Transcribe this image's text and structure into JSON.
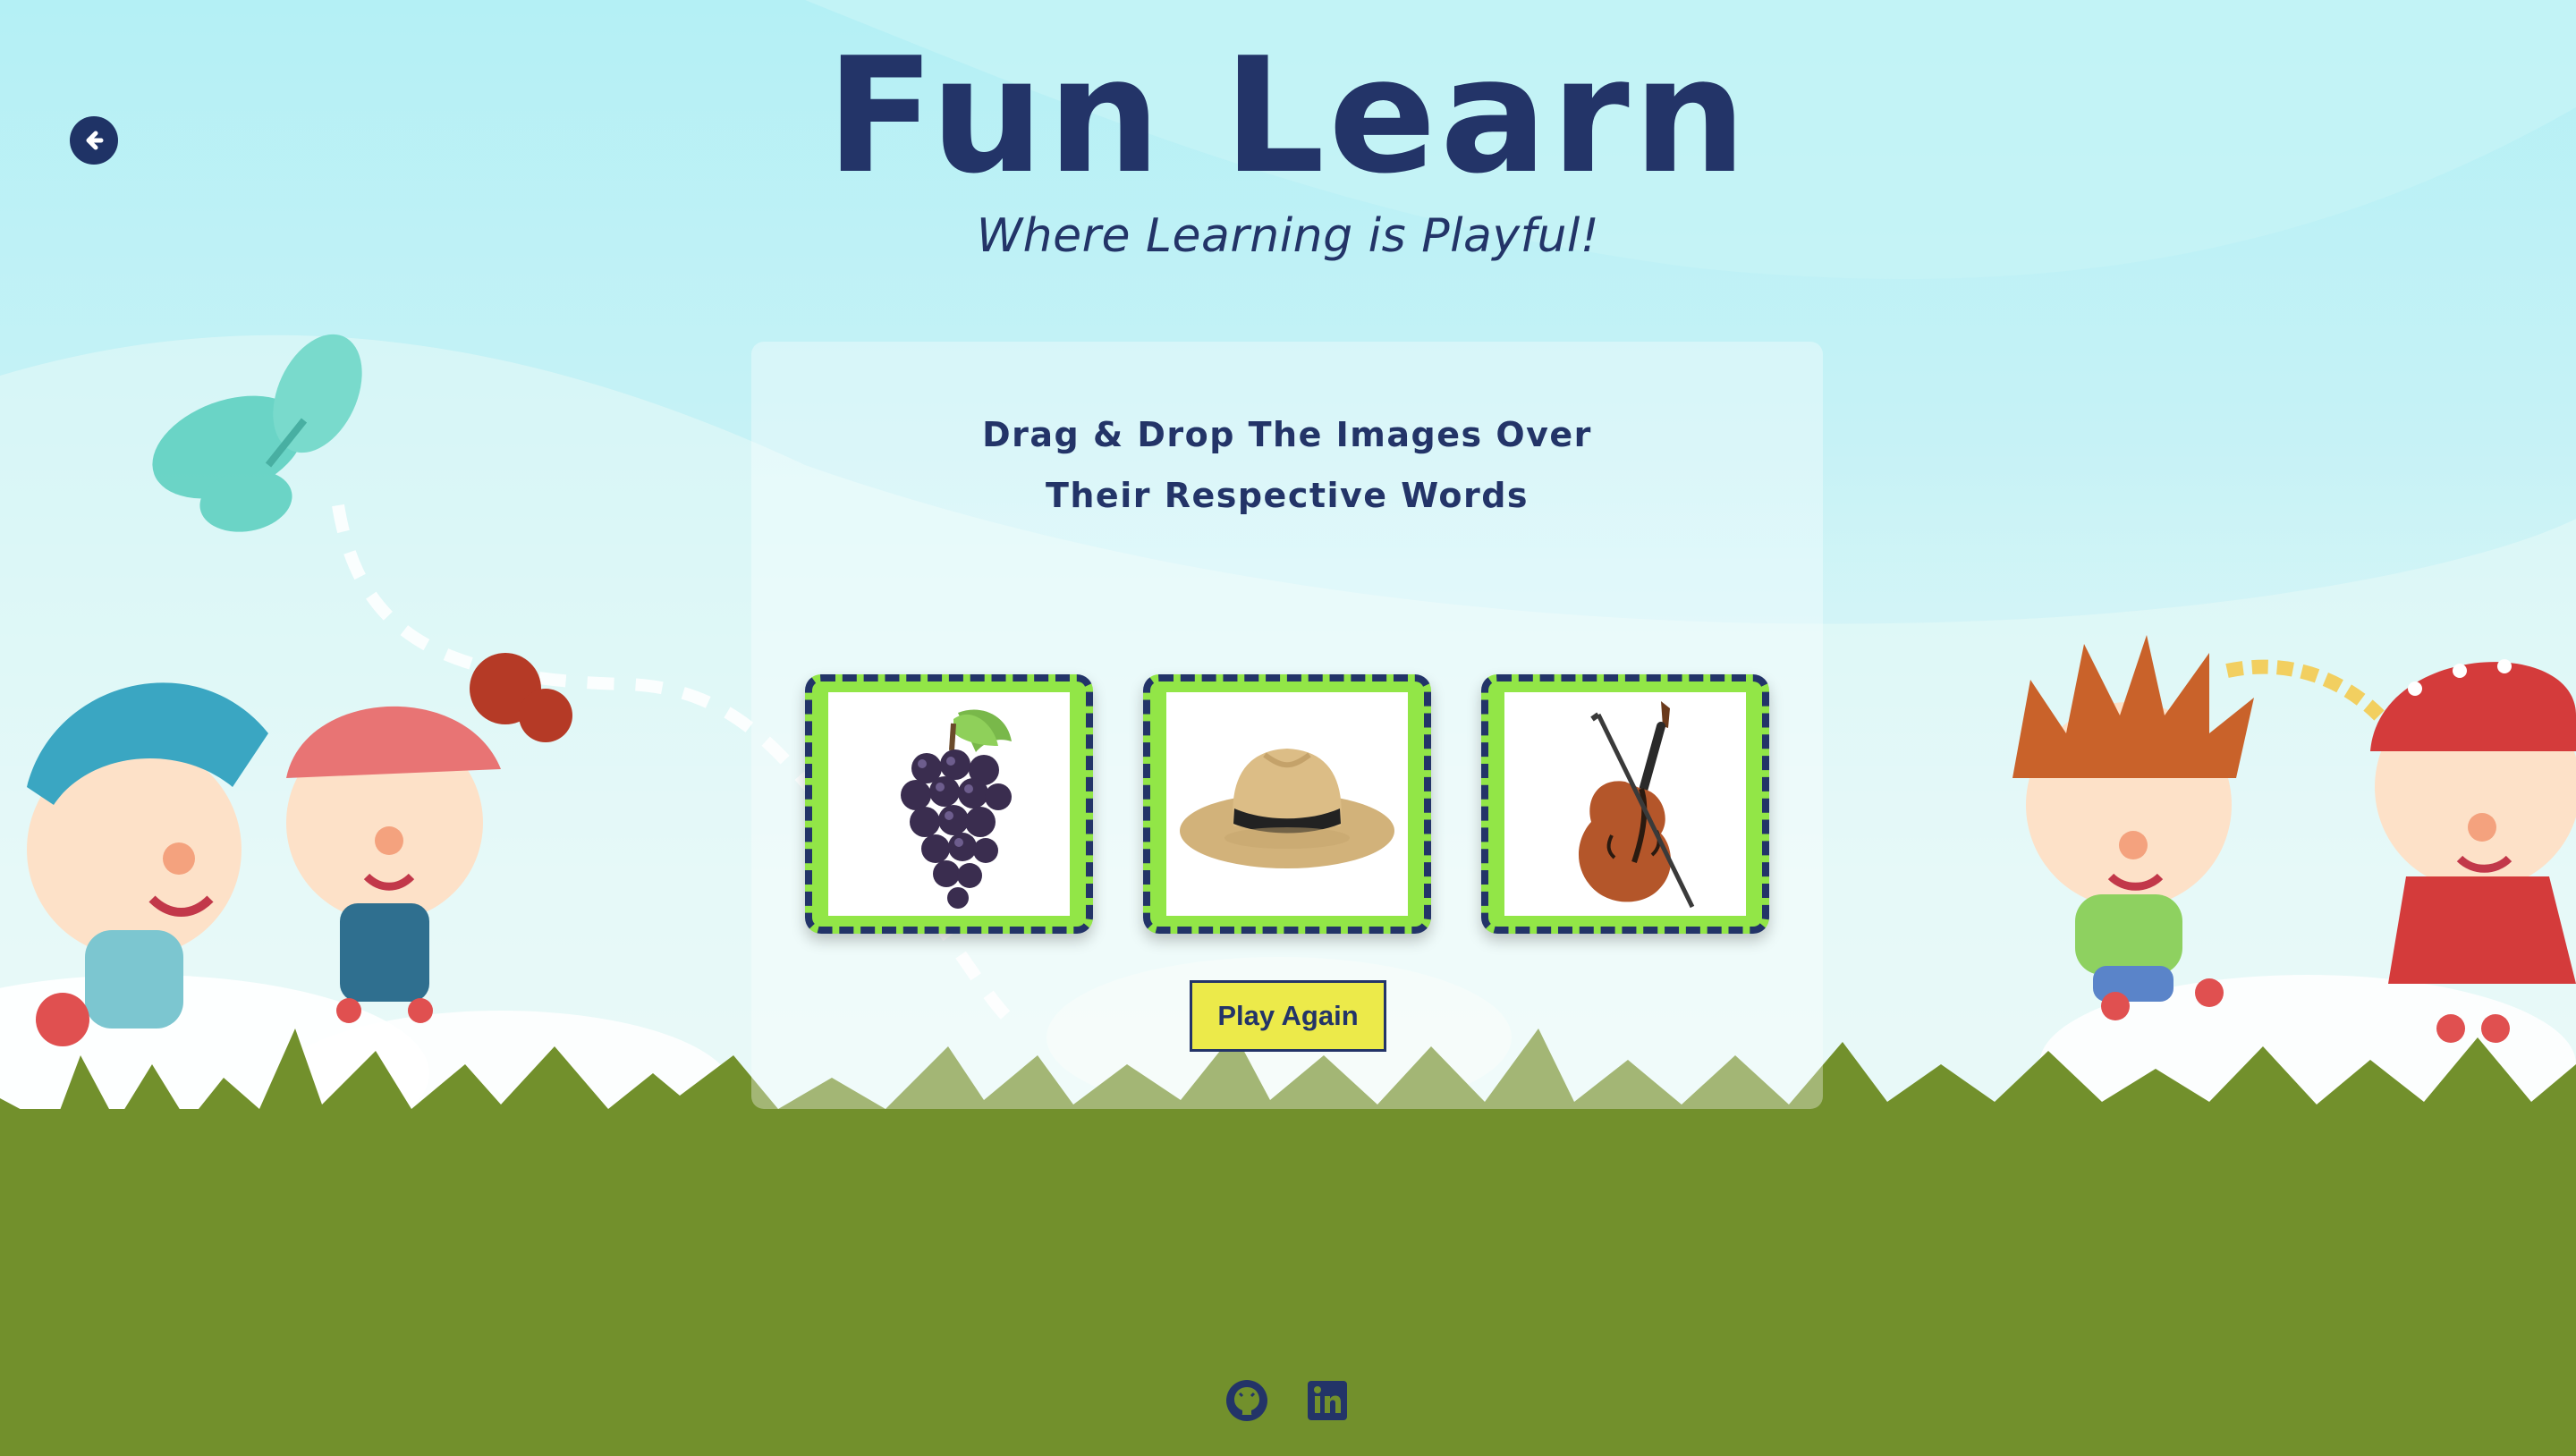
{
  "header": {
    "title": "Fun Learn",
    "subtitle": "Where Learning is Playful!"
  },
  "nav": {
    "back_icon": "arrow-left-circle-icon"
  },
  "game": {
    "instruction_line1": "Drag & Drop The Images Over",
    "instruction_line2": "Their Respective Words",
    "cards": [
      {
        "image": "grapes-image"
      },
      {
        "image": "hat-image"
      },
      {
        "image": "violin-image"
      }
    ],
    "play_again_label": "Play Again"
  },
  "footer": {
    "links": [
      {
        "icon": "github-icon"
      },
      {
        "icon": "linkedin-icon"
      }
    ]
  },
  "colors": {
    "primary_text": "#233468",
    "card_frame": "#92e647",
    "button_bg": "#ecea4a",
    "grass": "#72902c",
    "sky": "#b4f0f5"
  }
}
